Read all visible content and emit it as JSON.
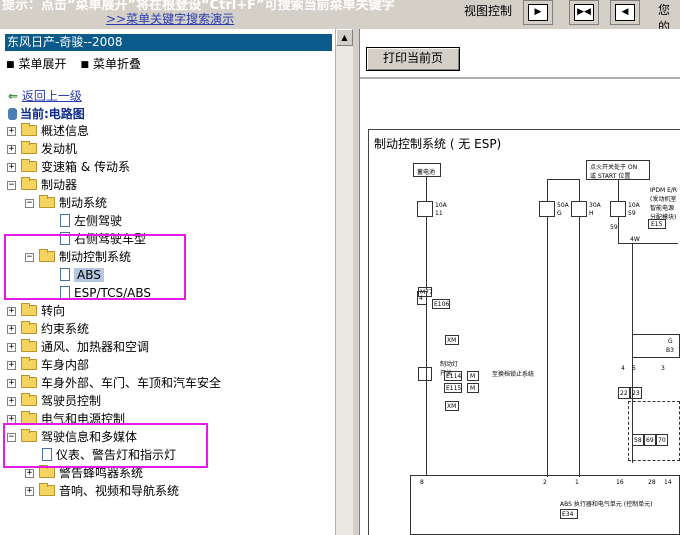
{
  "topbar": {
    "hint_text": "提示：点击“菜单展开”将在根登设“Ctrl+F”可搜索当前菜单关键字",
    "search_demo_link": ">>菜单关键字搜索演示",
    "view_control_label": "视图控制",
    "buttons": [
      {
        "name": "right-arrow",
        "glyph": "▶"
      },
      {
        "name": "collapse-arrows",
        "glyph": "▶◀"
      },
      {
        "name": "left-arrow",
        "glyph": "◀"
      }
    ],
    "truncated_text": "您的"
  },
  "left_pane": {
    "title": "东风日产-奇骏--2008",
    "menu_expand": "菜单展开",
    "menu_collapse": "菜单折叠",
    "back_link": "返回上一级",
    "current_label": "当前:电路图",
    "tree": [
      {
        "label": "概述信息",
        "state": "collapsed",
        "type": "folder"
      },
      {
        "label": "发动机",
        "state": "collapsed",
        "type": "folder"
      },
      {
        "label": "变速箱 & 传动系",
        "state": "collapsed",
        "type": "folder"
      },
      {
        "label": "制动器",
        "state": "expanded",
        "type": "folder"
      },
      {
        "label": "制动系统",
        "state": "expanded",
        "type": "folder"
      },
      {
        "label": "左侧驾驶",
        "type": "doc"
      },
      {
        "label": "右侧驾驶车型",
        "type": "doc"
      },
      {
        "label": "制动控制系统",
        "state": "expanded",
        "type": "folder"
      },
      {
        "label": "ABS",
        "type": "doc",
        "selected": true
      },
      {
        "label": "ESP/TCS/ABS",
        "type": "doc"
      },
      {
        "label": "转向",
        "state": "collapsed",
        "type": "folder"
      },
      {
        "label": "约束系统",
        "state": "collapsed",
        "type": "folder"
      },
      {
        "label": "通风、加热器和空调",
        "state": "collapsed",
        "type": "folder"
      },
      {
        "label": "车身内部",
        "state": "collapsed",
        "type": "folder"
      },
      {
        "label": "车身外部、车门、车顶和汽车安全",
        "state": "collapsed",
        "type": "folder"
      },
      {
        "label": "驾驶员控制",
        "state": "collapsed",
        "type": "folder"
      },
      {
        "label": "电气和电源控制",
        "state": "collapsed",
        "type": "folder"
      },
      {
        "label": "驾驶信息和多媒体",
        "state": "expanded",
        "type": "folder"
      },
      {
        "label": "仪表、警告灯和指示灯",
        "type": "doc"
      },
      {
        "label": "警告蜂鸣器系统",
        "state": "collapsed",
        "type": "folder"
      },
      {
        "label": "音响、视频和导航系统",
        "state": "collapsed",
        "type": "folder"
      }
    ],
    "highlight_color": "#e61ae6"
  },
  "right_pane": {
    "print_button": "打印当前页",
    "diagram_title": "制动控制系统 ( 无 ESP)",
    "labels": {
      "battery": "蓄电池",
      "ignition": "点火开关处于 ON\n或 START 位置",
      "ipdm": "IPDM E/R\n(发动机室\n智能电源\n分配模块)",
      "fuse1_amp": "10A",
      "fuse1_no": "11",
      "fuse2_amp": "50A",
      "fuse2_no": "G",
      "fuse3_amp": "30A",
      "fuse3_no": "H",
      "fuse4_amp": "10A",
      "fuse4_no": "59",
      "e15": "E15",
      "w4": "4W",
      "m77": "M77",
      "e106": "E106",
      "xm": "XM",
      "stoplamp": "制动灯\n开关",
      "e114": "E114",
      "e115": "E115",
      "m": "M",
      "interlock": "至换档锁止系统",
      "abs_unit": "ABS 执行器和电气单元 (控制单元)",
      "e34": "E34",
      "pin_59": "59",
      "pin_8": "8",
      "pin_2": "2",
      "pin_1": "1",
      "pin_16": "16",
      "pin_28": "28",
      "pin_14": "14",
      "pin_4": "4",
      "pin_5": "5",
      "pins_a": [
        "22",
        "23"
      ],
      "pins_b": [
        "58",
        "69",
        "70"
      ],
      "pin_3": "3",
      "pin_4b": "4",
      "g_label": "G",
      "b3": "B3"
    }
  },
  "colors": {
    "title_bg": "#0a5a8c",
    "link": "#2a3cb0",
    "selected_bg": "#b5c7de",
    "chrome": "#d4d0c8"
  }
}
